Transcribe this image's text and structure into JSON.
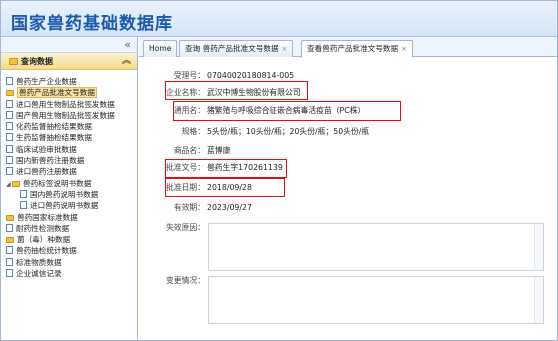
{
  "app": {
    "title": "国家兽药基础数据库"
  },
  "sidebar": {
    "collapse_glyph": "«",
    "panel_title": "查询数据",
    "panel_toggle": "︽",
    "items": [
      {
        "label": "兽药生产企业数据",
        "icon": "doc-icon",
        "indent": 0
      },
      {
        "label": "兽药产品批准文号数据",
        "icon": "folder-icon",
        "indent": 0,
        "selected": true
      },
      {
        "label": "进口兽用生物制品批签发数据",
        "icon": "doc-icon",
        "indent": 0
      },
      {
        "label": "国产兽用生物制品批签发数据",
        "icon": "doc-icon",
        "indent": 0
      },
      {
        "label": "化药监督抽检结果数据",
        "icon": "doc-icon",
        "indent": 0
      },
      {
        "label": "生药监督抽检结果数据",
        "icon": "doc-icon",
        "indent": 0
      },
      {
        "label": "临床试验审批数据",
        "icon": "doc-icon",
        "indent": 0
      },
      {
        "label": "国内新兽药注册数据",
        "icon": "doc-icon",
        "indent": 0
      },
      {
        "label": "进口兽药注册数据",
        "icon": "doc-icon",
        "indent": 0
      },
      {
        "label": "兽药标签说明书数据",
        "icon": "folder-icon",
        "indent": 0,
        "caret": "◢"
      },
      {
        "label": "国内兽药说明书数据",
        "icon": "doc-icon",
        "indent": 1
      },
      {
        "label": "进口兽药说明书数据",
        "icon": "doc-icon",
        "indent": 1
      },
      {
        "label": "兽药国家标准数据",
        "icon": "folder-icon",
        "indent": 0
      },
      {
        "label": "耐药性检测数据",
        "icon": "doc-icon",
        "indent": 0
      },
      {
        "label": "菌（毒）种数据",
        "icon": "folder-icon",
        "indent": 0
      },
      {
        "label": "兽药抽检统计数据",
        "icon": "doc-icon",
        "indent": 0
      },
      {
        "label": "标准物质数据",
        "icon": "doc-icon",
        "indent": 0
      },
      {
        "label": "企业诚信记录",
        "icon": "doc-icon",
        "indent": 0
      }
    ]
  },
  "tabs": [
    {
      "label": "Home",
      "closable": false
    },
    {
      "label": "查询 兽药产品批准文号数据",
      "closable": true
    },
    {
      "label": "查看兽药产品批准文号数据",
      "closable": true,
      "active": true
    }
  ],
  "tab_close_glyph": "×",
  "detail": {
    "fields": [
      {
        "label": "受理号：",
        "value": "07040020180814-005"
      },
      {
        "label": "企业名称：",
        "value": "武汉中博生物股份有限公司",
        "highlight": true
      },
      {
        "label": "通用名：",
        "value": "猪繁殖与呼吸综合征嵌合病毒活疫苗（PC株）",
        "highlight": true
      },
      {
        "label": "规格：",
        "value": "5头份/瓶；10头份/瓶；20头份/瓶；50头份/瓶"
      },
      {
        "label": "商品名：",
        "value": "蓝博康"
      },
      {
        "label": "批准文号：",
        "value": "兽药生字170261139",
        "highlight": true
      },
      {
        "label": "批准日期：",
        "value": "2018/09/28",
        "highlight": true
      },
      {
        "label": "有效期：",
        "value": "2023/09/27"
      }
    ],
    "invalid_reason_label": "失效原因：",
    "change_label": "变更情况："
  },
  "colors": {
    "highlight_border": "#e01010",
    "title": "#1c5aa8"
  }
}
